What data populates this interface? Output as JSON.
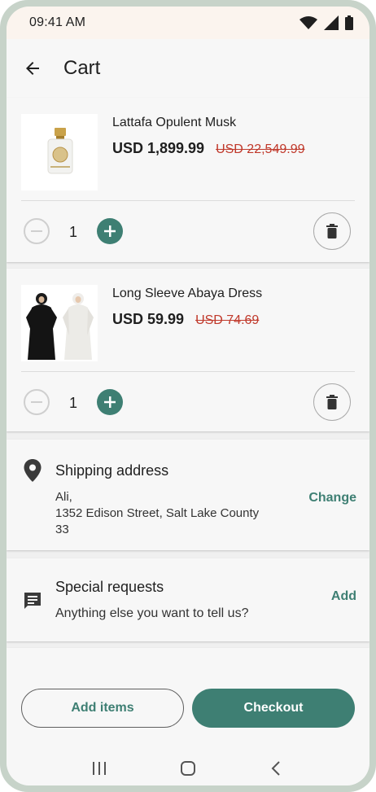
{
  "status_bar": {
    "time": "09:41 AM"
  },
  "app_bar": {
    "title": "Cart"
  },
  "cart_items": [
    {
      "name": "Lattafa Opulent Musk",
      "price": "USD 1,899.99",
      "old_price": "USD 22,549.99",
      "quantity": "1"
    },
    {
      "name": " Long Sleeve Abaya Dress",
      "price": "USD 59.99",
      "old_price": "USD 74.69",
      "quantity": "1"
    }
  ],
  "shipping": {
    "title": "Shipping address",
    "name": "Ali,",
    "street": "1352 Edison Street, Salt Lake County",
    "zip": "33",
    "action": "Change"
  },
  "special_requests": {
    "title": "Special requests",
    "subtitle": "Anything else you want to tell us?",
    "action": "Add"
  },
  "footer": {
    "add_items": "Add items",
    "checkout": "Checkout"
  },
  "colors": {
    "accent": "#3e7f73",
    "old_price": "#c0392b"
  },
  "icons": {
    "back": "arrow-left-icon",
    "minus": "minus-circle-icon",
    "plus": "plus-circle-icon",
    "delete": "trash-icon",
    "location": "location-pin-icon",
    "message": "message-icon"
  }
}
